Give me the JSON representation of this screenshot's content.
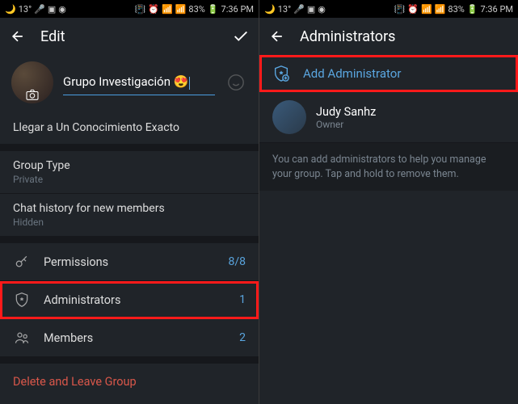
{
  "statusbar": {
    "temp": "13°",
    "battery": "83%",
    "time": "7:36 PM"
  },
  "left": {
    "title": "Edit",
    "group_name": "Grupo Investigación 😍",
    "description": "Llegar a Un Conocimiento Exacto",
    "group_type_label": "Group Type",
    "group_type_value": "Private",
    "history_label": "Chat history for new members",
    "history_value": "Hidden",
    "permissions_label": "Permissions",
    "permissions_value": "8/8",
    "admins_label": "Administrators",
    "admins_value": "1",
    "members_label": "Members",
    "members_value": "2",
    "delete_label": "Delete and Leave Group"
  },
  "right": {
    "title": "Administrators",
    "add_label": "Add Administrator",
    "owner_name": "Judy Sanhz",
    "owner_role": "Owner",
    "help": "You can add administrators to help you manage your group. Tap and hold to remove them."
  }
}
